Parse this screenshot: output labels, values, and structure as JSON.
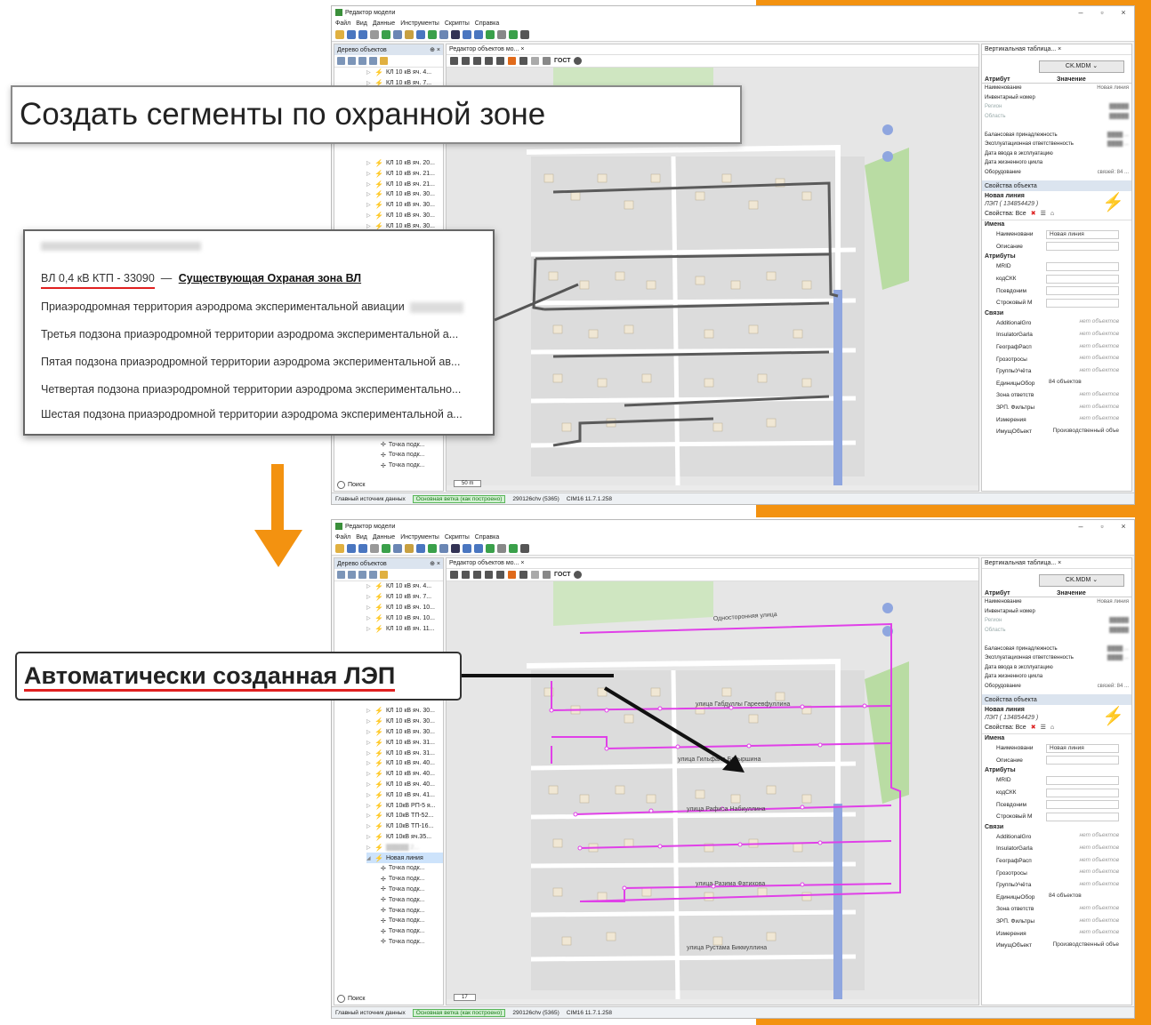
{
  "app": {
    "window_title": "Редактор модели",
    "menu": [
      "Файл",
      "Вид",
      "Данные",
      "Инструменты",
      "Скрипты",
      "Справка"
    ],
    "left_panel_title": "Дерево объектов",
    "map_tab": "Редактор объектов мо...",
    "map_tool_label": "ГОСТ",
    "right_tab": "Вертикальная таблица...",
    "ckmdm": "CK.MDM",
    "attr_col": "Атрибут",
    "value_col": "Значение",
    "attributes": [
      {
        "name": "Наименование",
        "value": "Новая линия"
      },
      {
        "name": "Инвентарный номер",
        "value": ""
      },
      {
        "name": "Регион",
        "value": "▓▓▓▓▓"
      },
      {
        "name": "Область",
        "value": "▓▓▓▓▓"
      },
      {
        "name": "",
        "value": ""
      },
      {
        "name": "Балансовая принадлежность",
        "value": "▓▓▓▓ ..."
      },
      {
        "name": "Эксплуатационная ответственность",
        "value": "▓▓▓▓ ..."
      },
      {
        "name": "Дата ввода в эксплуатацию",
        "value": ""
      },
      {
        "name": "Дата жизненного цикла",
        "value": ""
      },
      {
        "name": "Оборудование",
        "value": "связей: 84 ..."
      }
    ],
    "props_title": "Свойства объекта",
    "object_name": "Новая линия",
    "object_sub": "ЛЭП ( 134854429 )",
    "props_filter": "Свойства: Все",
    "groups": {
      "names": "Имена",
      "attrs": "Атрибуты",
      "links": "Связи"
    },
    "name_props": [
      {
        "name": "Наименовани",
        "value": "Новая линия",
        "plain": false
      },
      {
        "name": "Описание",
        "value": "",
        "plain": false
      }
    ],
    "attr_props": [
      {
        "name": "MRID",
        "value": ""
      },
      {
        "name": "кодСКК",
        "value": ""
      },
      {
        "name": "Псевдоним",
        "value": ""
      },
      {
        "name": "Строковый М",
        "value": ""
      }
    ],
    "link_props": [
      {
        "name": "AdditionalGro",
        "value": "нет объектов"
      },
      {
        "name": "InsulatorGarla",
        "value": "нет объектов"
      },
      {
        "name": "ГеографРасп",
        "value": "нет объектов"
      },
      {
        "name": "Грозотросы",
        "value": "нет объектов"
      },
      {
        "name": "ГруппыУчёта",
        "value": "нет объектов"
      },
      {
        "name": "ЕдиницыОбор",
        "value": "84 объектов"
      },
      {
        "name": "Зона ответств",
        "value": "нет объектов"
      },
      {
        "name": "ЗРП. Фильтры",
        "value": "нет объектов"
      },
      {
        "name": "Измерения",
        "value": "нет объектов"
      },
      {
        "name": "ИмущОбъект",
        "value": "Производственный объе"
      }
    ],
    "search_label": "Поиск",
    "scale_label": "50 m",
    "zoom_value": "17",
    "status": {
      "main_source": "Главный источник данных",
      "branch": "Основная ветка (как построено)",
      "count": "290126chv (5365)",
      "version": "CIM16 11.7.1.258"
    }
  },
  "tree_top": [
    "КЛ 10 кВ яч. 4...",
    "КЛ 10 кВ яч. 7...",
    "КЛ 10 кВ яч. 20...",
    "КЛ 10 кВ яч. 21...",
    "КЛ 10 кВ яч. 21...",
    "КЛ 10 кВ яч. 30...",
    "КЛ 10 кВ яч. 30...",
    "КЛ 10 кВ яч. 30...",
    "КЛ 10 кВ яч. 30..."
  ],
  "tree_top_children": [
    "Точка подк...",
    "Точка подк...",
    "Точка подк..."
  ],
  "tree_bottom": [
    "КЛ 10 кВ яч. 4...",
    "КЛ 10 кВ яч. 7...",
    "КЛ 10 кВ яч. 10...",
    "КЛ 10 кВ яч. 10...",
    "КЛ 10 кВ яч. 11...",
    "КЛ 10 кВ яч. 30...",
    "КЛ 10 кВ яч. 30...",
    "КЛ 10 кВ яч. 30...",
    "КЛ 10 кВ яч. 31...",
    "КЛ 10 кВ яч. 31...",
    "КЛ 10 кВ яч. 40...",
    "КЛ 10 кВ яч. 40...",
    "КЛ 10 кВ яч. 40...",
    "КЛ 10 кВ яч. 41...",
    "КЛ 10кВ РП-5 я...",
    "КЛ 10кВ ТП-52...",
    "КЛ 10кВ ТП-16...",
    "КЛ 10кВ яч.35...",
    "▓▓▓▓▓ 2..."
  ],
  "tree_selected": "Новая линия",
  "tree_bottom_children": [
    "Точка подк...",
    "Точка подк...",
    "Точка подк...",
    "Точка подк...",
    "Точка подк...",
    "Точка подк...",
    "Точка подк...",
    "Точка подк...",
    "Точка подк..."
  ],
  "streets": [
    "Односторонняя улица",
    "улица Габдуллы Гареевфуллина",
    "улица Гильфана Батыршина",
    "улица Рафиса Набиуллина",
    "улица Разима Фатихова",
    "улица Рустама Бикмуллина"
  ],
  "callouts": {
    "create_segments": "Создать сегменты по охранной зоне",
    "blurred_header": "ЗЗ:ВВ:ЧЧЧ:РР.ЗЗ.ЧЧЧЧ",
    "existing_vl": "ВЛ 0,4 кВ КТП - 33090",
    "existing_zone": "Существующая Охраная зона ВЛ",
    "layers": [
      "Приаэродромная территория аэродрома экспериментальной авиации",
      "Третья подзона приаэродромной территории аэродрома экспериментальной а...",
      "Пятая подзона приаэродромной территории аэродрома экспериментальной ав...",
      "Четвертая подзона приаэродромной территории аэродрома экспериментально...",
      "Шестая подзона приаэродромной территории аэродрома экспериментальной а..."
    ],
    "auto_created": "Автоматически созданная ЛЭП"
  },
  "colors": {
    "accent": "#f39210",
    "line_existing": "#5a5a5a",
    "line_new": "#e040e8",
    "highlight": "#e02020"
  }
}
